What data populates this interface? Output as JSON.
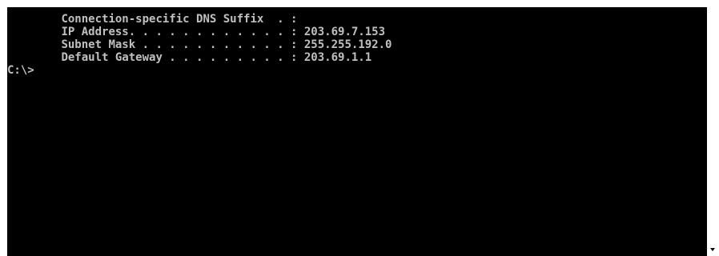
{
  "console": {
    "background_color": "#000000",
    "text_color": "#c0c0c0",
    "lines": [
      {
        "indent": "        ",
        "label": "Connection-specific DNS Suffix",
        "dots": "  . :",
        "value": ""
      },
      {
        "indent": "        ",
        "label": "IP Address",
        "dots": ". . . . . . . . . . . . :",
        "value": " 203.69.7.153"
      },
      {
        "indent": "        ",
        "label": "Subnet Mask",
        "dots": " . . . . . . . . . . . :",
        "value": " 255.255.192.0"
      },
      {
        "indent": "        ",
        "label": "Default Gateway",
        "dots": " . . . . . . . . . :",
        "value": " 203.69.1.1"
      }
    ],
    "prompt": "C:\\>"
  },
  "scrollbar": {
    "down_arrow_icon": "triangle-down"
  }
}
